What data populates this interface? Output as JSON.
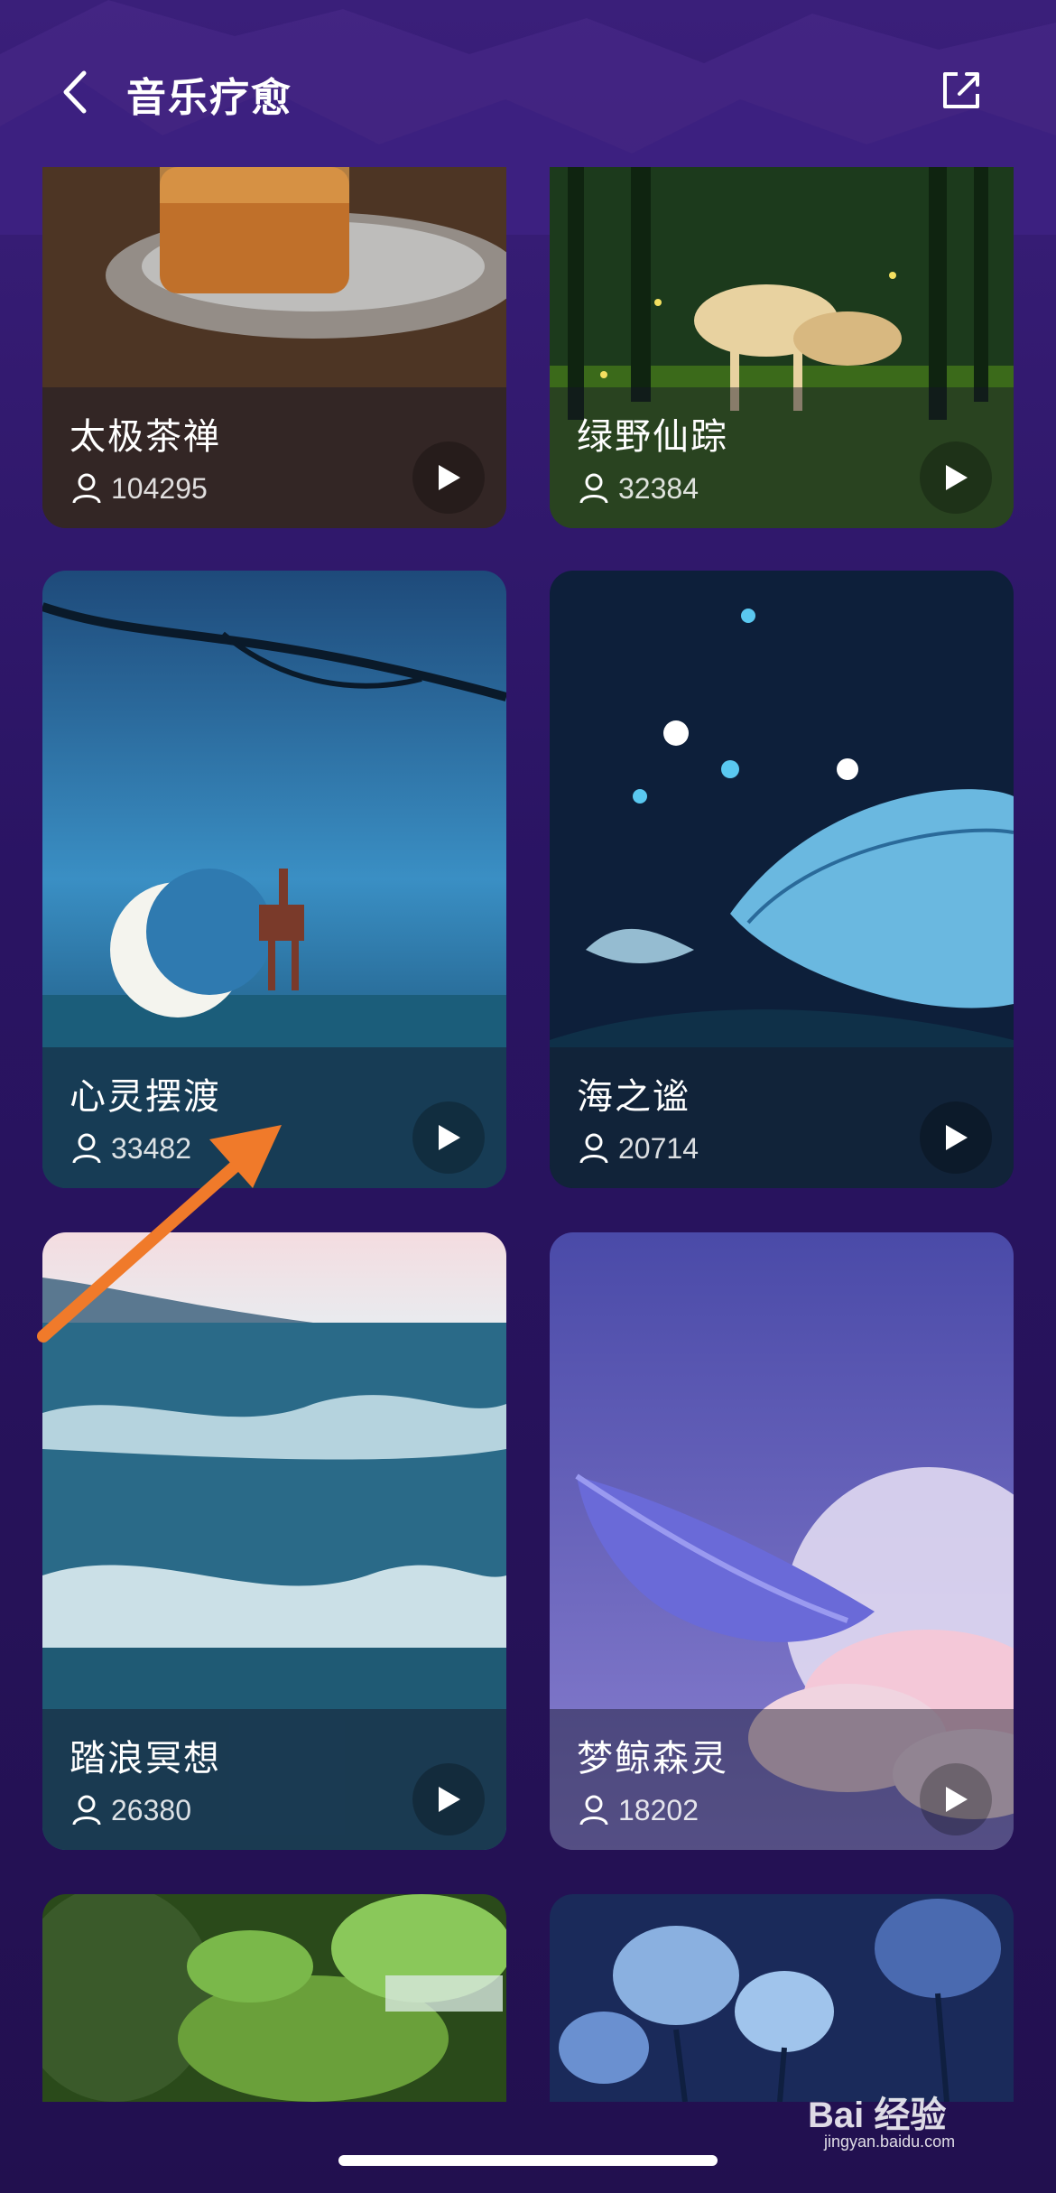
{
  "header": {
    "title": "音乐疗愈",
    "back_icon": "chevron-left-icon",
    "share_icon": "share-icon"
  },
  "cards": [
    {
      "title": "太极茶禅",
      "listeners": "104295",
      "theme": "tea"
    },
    {
      "title": "绿野仙踪",
      "listeners": "32384",
      "theme": "forest-deer"
    },
    {
      "title": "心灵摆渡",
      "listeners": "33482",
      "theme": "moon-deer"
    },
    {
      "title": "海之谧",
      "listeners": "20714",
      "theme": "whale-night"
    },
    {
      "title": "踏浪冥想",
      "listeners": "26380",
      "theme": "ocean-waves"
    },
    {
      "title": "梦鲸森灵",
      "listeners": "18202",
      "theme": "whale-clouds"
    },
    {
      "title": "",
      "listeners": "",
      "theme": "mossy-stream"
    },
    {
      "title": "",
      "listeners": "",
      "theme": "blue-flowers"
    }
  ],
  "watermark": {
    "brand": "Bai 经验",
    "url": "jingyan.baidu.com"
  },
  "colors": {
    "background": "#2a1463",
    "accent_arrow": "#f07a2a"
  }
}
